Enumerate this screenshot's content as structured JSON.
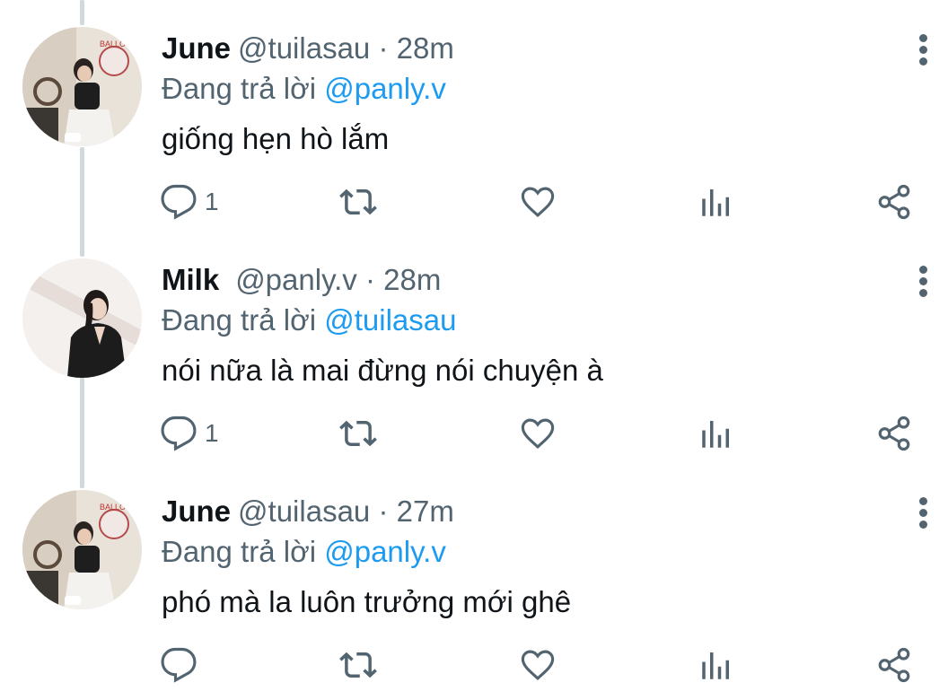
{
  "colors": {
    "text": "#0f1419",
    "secondary": "#536471",
    "mention": "#1d9bf0",
    "thread_line": "#cfd9de"
  },
  "tweets": [
    {
      "name": "June",
      "handle": "@tuilasau",
      "separator": "·",
      "time": "28m",
      "reply_prefix": "Đang trả lời",
      "reply_to": "@panly.v",
      "text": "giống hẹn hò lắm",
      "reply_count": "1",
      "avatar_icon": "avatar-june"
    },
    {
      "name": "Milk",
      "handle": "@panly.v",
      "separator": "·",
      "time": "28m",
      "reply_prefix": "Đang trả lời",
      "reply_to": "@tuilasau",
      "text": "nói nữa là mai đừng nói chuyện à",
      "reply_count": "1",
      "avatar_icon": "avatar-milk"
    },
    {
      "name": "June",
      "handle": "@tuilasau",
      "separator": "·",
      "time": "27m",
      "reply_prefix": "Đang trả lời",
      "reply_to": "@panly.v",
      "text": "phó mà la luôn trưởng mới ghê",
      "reply_count": "",
      "avatar_icon": "avatar-june"
    }
  ],
  "icons": [
    "reply-icon",
    "retweet-icon",
    "like-icon",
    "views-icon",
    "share-icon",
    "more-options-icon"
  ]
}
